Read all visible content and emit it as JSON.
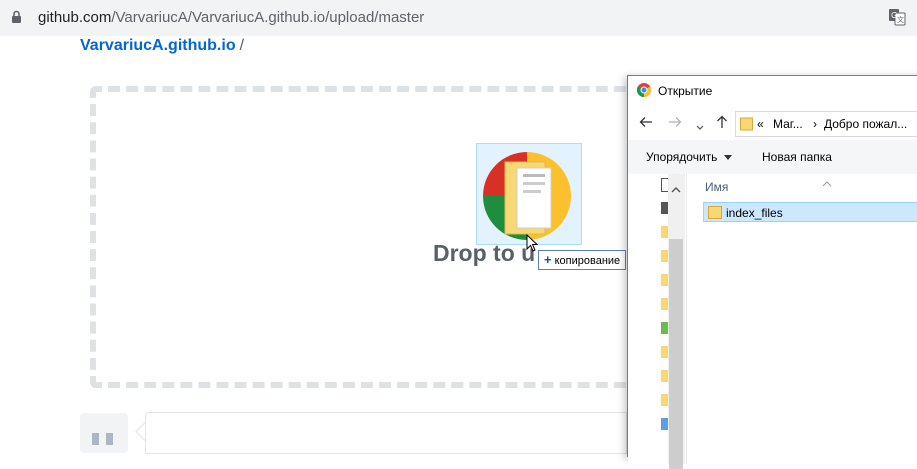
{
  "browser": {
    "url_host": "github.com",
    "url_path": "/VarvariucA/VarvariucA.github.io/upload/master"
  },
  "repo": {
    "name": "VarvariucA.github.io",
    "separator": "/"
  },
  "dropzone": {
    "text": "Drop to u⁠pload"
  },
  "drag": {
    "tooltip": "копирование",
    "plus": "+"
  },
  "dialog": {
    "title": "Открытие",
    "path": {
      "prefix": "«",
      "seg1": "Маг...",
      "arrow": "›",
      "seg2": "Добро пожал..."
    },
    "toolbar": {
      "organize": "Упорядочить",
      "new_folder": "Новая папка"
    },
    "columns": {
      "name": "Имя"
    },
    "files": [
      {
        "name": "index_files"
      }
    ]
  },
  "colors": {
    "link": "#0366d6",
    "selection": "#cce8ff",
    "folder": "#f8d775"
  }
}
